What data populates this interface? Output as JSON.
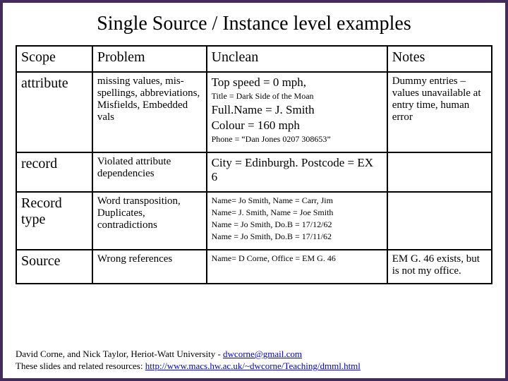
{
  "title": "Single Source / Instance level examples",
  "headers": [
    "Scope",
    "Problem",
    "Unclean",
    "Notes"
  ],
  "rows": [
    {
      "scope": "attribute",
      "problem": "missing values, mis-spellings, abbreviations, Misfields, Embedded vals",
      "unclean": [
        {
          "style": "big",
          "text": "Top speed = 0 mph,"
        },
        {
          "style": "small",
          "text": "Title = Dark Side of the Moan"
        },
        {
          "style": "big",
          "text": "Full.Name = J. Smith"
        },
        {
          "style": "big",
          "text": "Colour = 160 mph"
        },
        {
          "style": "small",
          "text": "Phone = “Dan Jones 0207 308653”"
        }
      ],
      "notes": "Dummy entries – values unavailable at entry time, human error"
    },
    {
      "scope": "record",
      "problem": "Violated attribute dependencies",
      "unclean": [
        {
          "style": "big",
          "text": "City = Edinburgh. Postcode = EX 6"
        }
      ],
      "notes": ""
    },
    {
      "scope": "Record type",
      "problem": "Word transposition, Duplicates, contradictions",
      "unclean": [
        {
          "style": "small",
          "text": "Name= Jo Smith, Name = Carr, Jim"
        },
        {
          "style": "small",
          "text": "Name= J. Smith, Name = Joe Smith"
        },
        {
          "style": "small",
          "text": "Name = Jo Smith, Do.B = 17/12/62"
        },
        {
          "style": "small",
          "text": "Name = Jo Smith, Do.B = 17/11/62"
        }
      ],
      "notes": ""
    },
    {
      "scope": "Source",
      "problem": "Wrong references",
      "unclean": [
        {
          "style": "small",
          "text": "Name= D Corne, Office = EM G. 46"
        }
      ],
      "notes": "EM G. 46 exists, but is not my office."
    }
  ],
  "footer": {
    "line1_prefix": "David Corne, and Nick Taylor,  Heriot-Watt University  -  ",
    "line1_link": "dwcorne@gmail.com",
    "line2_prefix": "These slides and related resources:   ",
    "line2_link": "http://www.macs.hw.ac.uk/~dwcorne/Teaching/dmml.html"
  }
}
